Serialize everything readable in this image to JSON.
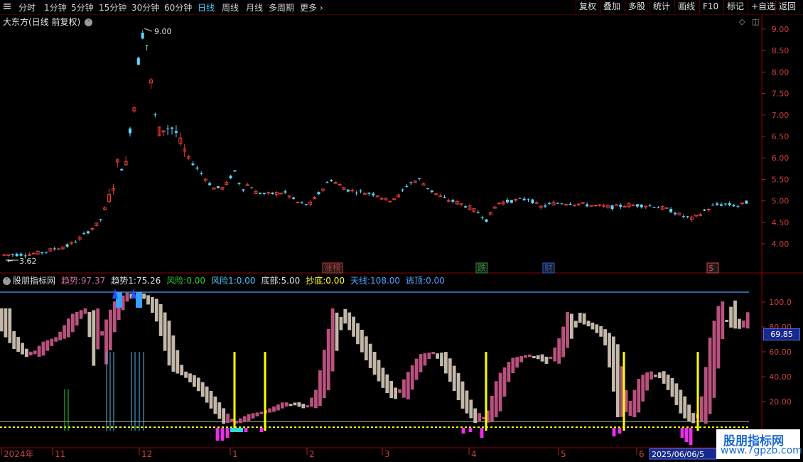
{
  "toolbar": {
    "periods": [
      "分时",
      "1分钟",
      "5分钟",
      "15分钟",
      "30分钟",
      "60分钟",
      "日线",
      "周线",
      "月线",
      "多周期",
      "更多"
    ],
    "active_period": "日线",
    "more_chevron_icon": "chevron-right-icon",
    "buttons": [
      "复权",
      "叠加",
      "多股",
      "统计",
      "画线",
      "F10",
      "标记",
      "+自选",
      "返回"
    ]
  },
  "main_chart": {
    "title": "大东方(日线 前复权)",
    "high_label": "9.00",
    "low_label": "3.62",
    "price_ticks": [
      "9.00",
      "8.50",
      "8.00",
      "7.50",
      "7.00",
      "6.50",
      "6.00",
      "5.50",
      "5.00",
      "4.50",
      "4.00"
    ],
    "event_tags": [
      {
        "label": "涨榜",
        "color": "#c23a3a"
      },
      {
        "label": "跌",
        "color": "#2e8b2e"
      },
      {
        "label": "财",
        "color": "#2a5bd6"
      },
      {
        "label": "$",
        "color": "#e04040"
      }
    ]
  },
  "indicator": {
    "name": "股朋指标网",
    "values": [
      {
        "label": "趋势:",
        "value": "97.37",
        "color": "#c86a9a"
      },
      {
        "label": "趋势1:",
        "value": "75.26",
        "color": "#e0e0e0"
      },
      {
        "label": "风险:",
        "value": "0.00",
        "color": "#33cc33"
      },
      {
        "label": "风险1:",
        "value": "0.00",
        "color": "#4fc3ff"
      },
      {
        "label": "底部:",
        "value": "5.00",
        "color": "#e0e0e0"
      },
      {
        "label": "抄底:",
        "value": "0.00",
        "color": "#ffff33"
      },
      {
        "label": "天线:",
        "value": "108.00",
        "color": "#4fa0ff"
      },
      {
        "label": "逃顶:",
        "value": "0.00",
        "color": "#4fa0ff"
      }
    ],
    "y_ticks": [
      "100.0",
      "80.00",
      "60.00",
      "40.00",
      "20.00"
    ],
    "current_value": "69.85"
  },
  "time_axis": {
    "labels": [
      "2024年",
      "11",
      "12",
      "1",
      "2",
      "3",
      "4",
      "5",
      "6"
    ],
    "current_date": "2025/06/06/5"
  },
  "watermark": {
    "line1": "股朋指标网",
    "line2": "www.7gpzb.com"
  },
  "colors": {
    "up": "#e03a3a",
    "down": "#5fd8ff",
    "trend_up": "#b8517e",
    "trend_down": "#c4b8aa",
    "signal": "#ffff00",
    "antenna": "#4aa0ff"
  }
}
